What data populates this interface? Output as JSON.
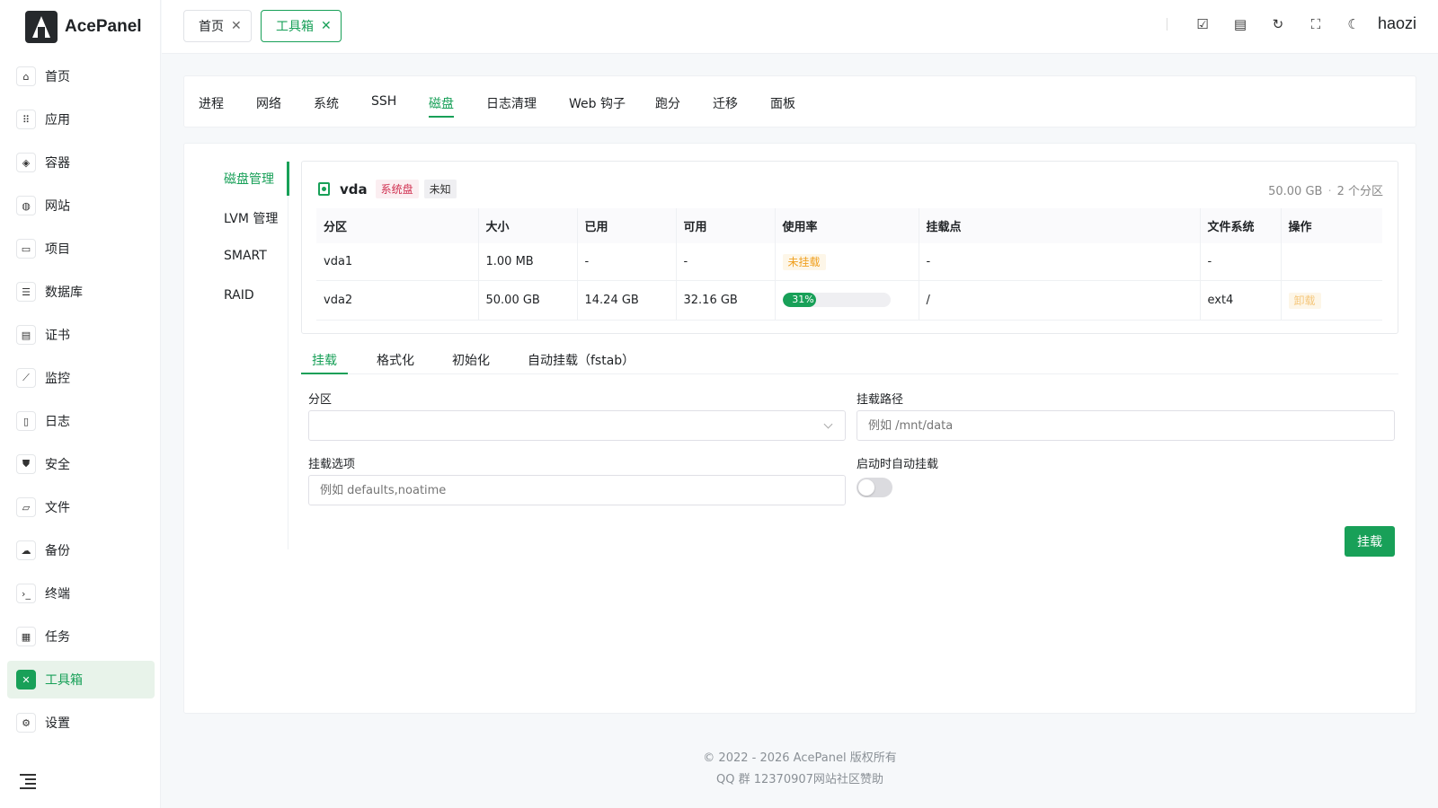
{
  "app": {
    "name": "AcePanel",
    "user": "haozi"
  },
  "header": {
    "tabs": [
      {
        "label": "首页",
        "active": false
      },
      {
        "label": "工具箱",
        "active": true
      }
    ]
  },
  "sidebar": {
    "items": [
      {
        "label": "首页",
        "icon": "home-icon"
      },
      {
        "label": "应用",
        "icon": "apps-grid-icon"
      },
      {
        "label": "容器",
        "icon": "layers-icon"
      },
      {
        "label": "网站",
        "icon": "globe-icon"
      },
      {
        "label": "项目",
        "icon": "folders-icon"
      },
      {
        "label": "数据库",
        "icon": "database-icon"
      },
      {
        "label": "证书",
        "icon": "certificate-icon"
      },
      {
        "label": "监控",
        "icon": "chart-line-icon"
      },
      {
        "label": "日志",
        "icon": "file-text-icon"
      },
      {
        "label": "安全",
        "icon": "shield-icon"
      },
      {
        "label": "文件",
        "icon": "folder-open-icon"
      },
      {
        "label": "备份",
        "icon": "cloud-upload-icon"
      },
      {
        "label": "终端",
        "icon": "terminal-icon"
      },
      {
        "label": "任务",
        "icon": "calendar-task-icon"
      },
      {
        "label": "工具箱",
        "icon": "tools-icon",
        "active": true
      },
      {
        "label": "设置",
        "icon": "gear-icon"
      }
    ]
  },
  "toolbox_tabs": [
    "进程",
    "网络",
    "系统",
    "SSH",
    "磁盘",
    "日志清理",
    "Web 钩子",
    "跑分",
    "迁移",
    "面板"
  ],
  "toolbox_active": "磁盘",
  "disk_nav": [
    "磁盘管理",
    "LVM 管理",
    "SMART",
    "RAID"
  ],
  "disk": {
    "name": "vda",
    "tag_system": "系统盘",
    "tag_type": "未知",
    "size": "50.00 GB",
    "partitions_count": "2 个分区",
    "columns": [
      "分区",
      "大小",
      "已用",
      "可用",
      "使用率",
      "挂载点",
      "文件系统",
      "操作"
    ],
    "rows": [
      {
        "name": "vda1",
        "size": "1.00 MB",
        "used": "-",
        "avail": "-",
        "usage_label": "未挂载",
        "mount": "-",
        "fs": "-",
        "action": ""
      },
      {
        "name": "vda2",
        "size": "50.00 GB",
        "used": "14.24 GB",
        "avail": "32.16 GB",
        "usage_percent": 31,
        "usage_label": "31%",
        "mount": "/",
        "fs": "ext4",
        "action": "卸载"
      }
    ]
  },
  "mount_tabs": [
    "挂载",
    "格式化",
    "初始化",
    "自动挂载（fstab）"
  ],
  "mount_form": {
    "partition_label": "分区",
    "partition_value": "",
    "path_label": "挂载路径",
    "path_placeholder": "例如 /mnt/data",
    "options_label": "挂载选项",
    "options_placeholder": "例如 defaults,noatime",
    "auto_label": "启动时自动挂载",
    "auto_enabled": false,
    "submit": "挂载"
  },
  "footer": {
    "copyright": "© 2022 - 2026 AcePanel 版权所有",
    "qq": "QQ 群 12370907",
    "links": [
      "网站",
      "社区",
      "赞助"
    ]
  },
  "colors": {
    "accent": "#18a058",
    "danger": "#d03050",
    "warning": "#f0a020"
  }
}
